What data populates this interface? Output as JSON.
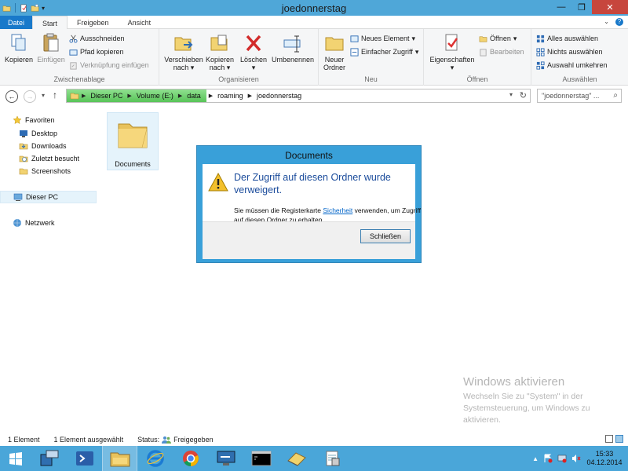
{
  "window": {
    "title": "joedonnerstag",
    "qat_dropdown": "▾",
    "min": "—",
    "max": "❐",
    "close": "✕"
  },
  "tabs": [
    "Datei",
    "Start",
    "Freigeben",
    "Ansicht"
  ],
  "ribbon": {
    "zwischenablage": {
      "label": "Zwischenablage",
      "copy": "Kopieren",
      "paste": "Einfügen",
      "cut": "Ausschneiden",
      "copy_path": "Pfad kopieren",
      "paste_shortcut": "Verknüpfung einfügen"
    },
    "organisieren": {
      "label": "Organisieren",
      "move_to_1": "Verschieben",
      "move_to_2": "nach",
      "copy_to_1": "Kopieren",
      "copy_to_2": "nach",
      "delete": "Löschen",
      "rename": "Umbenennen"
    },
    "neu": {
      "label": "Neu",
      "new_folder_1": "Neuer",
      "new_folder_2": "Ordner",
      "new_item": "Neues Element",
      "easy_access": "Einfacher Zugriff"
    },
    "oeffnen": {
      "label": "Öffnen",
      "properties": "Eigenschaften",
      "open": "Öffnen",
      "edit": "Bearbeiten"
    },
    "auswaehlen": {
      "label": "Auswählen",
      "select_all": "Alles auswählen",
      "select_none": "Nichts auswählen",
      "invert": "Auswahl umkehren"
    }
  },
  "address": {
    "crumbs": [
      "Dieser PC",
      "Volume (E:)",
      "data",
      "roaming",
      "joedonnerstag"
    ],
    "search_placeholder": "\"joedonnerstag\" ..."
  },
  "nav": {
    "favorites": "Favoriten",
    "desktop": "Desktop",
    "downloads": "Downloads",
    "recent": "Zuletzt besucht",
    "screenshots": "Screenshots",
    "this_pc": "Dieser PC",
    "network": "Netzwerk"
  },
  "content": {
    "folder_name": "Documents"
  },
  "dialog": {
    "title": "Documents",
    "main": "Der Zugriff auf diesen Ordner wurde verweigert.",
    "sub_pre": "Sie müssen die Registerkarte ",
    "sub_link": "Sicherheit",
    "sub_post": " verwenden, um Zugriff auf diesen Ordner zu erhalten.",
    "close_button": "Schließen"
  },
  "watermark": {
    "title": "Windows aktivieren",
    "text": "Wechseln Sie zu \"System\" in der Systemsteuerung, um Windows zu aktivieren."
  },
  "status": {
    "count": "1 Element",
    "selected": "1 Element ausgewählt",
    "status_label": "Status:",
    "shared": "Freigegeben"
  },
  "taskbar": {
    "time": "15:33",
    "date": "04.12.2014"
  },
  "colors": {
    "titlebar": "#4fa7d8",
    "file_tab": "#1979ca",
    "taskbar": "#4aa6d9",
    "dialog_frame": "#39a0d9",
    "breadcrumb": "#58c358",
    "heading_blue": "#1a4b9b",
    "close_red": "#c7463d"
  }
}
